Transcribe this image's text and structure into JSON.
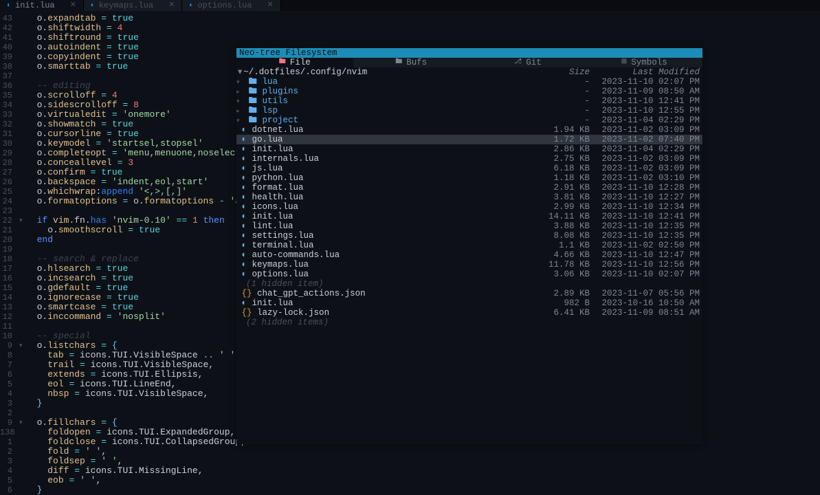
{
  "tabs": [
    {
      "name": "init.lua",
      "active": true
    },
    {
      "name": "keymaps.lua",
      "active": false
    },
    {
      "name": "options.lua",
      "active": false
    }
  ],
  "code": [
    {
      "n": "43",
      "c": "",
      "html": "  o.<span class='ident'>expandtab</span> <span class='op'>=</span> <span class='bool'>true</span>"
    },
    {
      "n": "42",
      "c": "",
      "html": "  o.<span class='ident'>shiftwidth</span> <span class='op'>=</span> <span class='num'>4</span>"
    },
    {
      "n": "41",
      "c": "",
      "html": "  o.<span class='ident'>shiftround</span> <span class='op'>=</span> <span class='bool'>true</span>"
    },
    {
      "n": "40",
      "c": "",
      "html": "  o.<span class='ident'>autoindent</span> <span class='op'>=</span> <span class='bool'>true</span>"
    },
    {
      "n": "39",
      "c": "",
      "html": "  o.<span class='ident'>copyindent</span> <span class='op'>=</span> <span class='bool'>true</span>"
    },
    {
      "n": "38",
      "c": "",
      "html": "  o.<span class='ident'>smarttab</span> <span class='op'>=</span> <span class='bool'>true</span>"
    },
    {
      "n": "37",
      "c": "",
      "html": ""
    },
    {
      "n": "36",
      "c": "",
      "html": "  <span class='comment'>-- editing</span>"
    },
    {
      "n": "35",
      "c": "",
      "html": "  o.<span class='ident'>scrolloff</span> <span class='op'>=</span> <span class='num'>4</span>"
    },
    {
      "n": "34",
      "c": "",
      "html": "  o.<span class='ident'>sidescrolloff</span> <span class='op'>=</span> <span class='num'>8</span>"
    },
    {
      "n": "33",
      "c": "",
      "html": "  o.<span class='ident'>virtualedit</span> <span class='op'>=</span> <span class='str'>'onemore'</span>"
    },
    {
      "n": "32",
      "c": "",
      "html": "  o.<span class='ident'>showmatch</span> <span class='op'>=</span> <span class='bool'>true</span>"
    },
    {
      "n": "31",
      "c": "",
      "html": "  o.<span class='ident'>cursorline</span> <span class='op'>=</span> <span class='bool'>true</span>"
    },
    {
      "n": "30",
      "c": "",
      "html": "  o.<span class='ident'>keymodel</span> <span class='op'>=</span> <span class='str'>'startsel,stopsel'</span>"
    },
    {
      "n": "29",
      "c": "",
      "html": "  o.<span class='ident'>completeopt</span> <span class='op'>=</span> <span class='str'>'menu,menuone,noselect'</span>"
    },
    {
      "n": "28",
      "c": "",
      "html": "  o.<span class='ident'>conceallevel</span> <span class='op'>=</span> <span class='num'>3</span>"
    },
    {
      "n": "27",
      "c": "",
      "html": "  o.<span class='ident'>confirm</span> <span class='op'>=</span> <span class='bool'>true</span>"
    },
    {
      "n": "26",
      "c": "",
      "html": "  o.<span class='ident'>backspace</span> <span class='op'>=</span> <span class='str'>'indent,eol,start'</span>"
    },
    {
      "n": "25",
      "c": "",
      "html": "  o.<span class='ident'>whichwrap</span>:<span class='fn'>append</span> <span class='str'>'<,>,[,]'</span>"
    },
    {
      "n": "24",
      "c": "",
      "html": "  o.<span class='ident'>formatoptions</span> <span class='op'>=</span> o.<span class='ident'>formatoptions</span> <span class='op'>-</span> <span class='str'>'a'</span> <span class='op'>-</span>"
    },
    {
      "n": "23",
      "c": "",
      "html": ""
    },
    {
      "n": "22",
      "c": "▾",
      "html": "  <span class='kw'>if</span> <span class='ident'>vim</span>.fn.<span class='fn'>has</span> <span class='str'>'nvim-0.10'</span> <span class='op'>==</span> <span class='num'>1</span> <span class='kw'>then</span>"
    },
    {
      "n": "21",
      "c": "",
      "html": "    o.<span class='ident'>smoothscroll</span> <span class='op'>=</span> <span class='bool'>true</span>"
    },
    {
      "n": "20",
      "c": "",
      "html": "  <span class='kw'>end</span>"
    },
    {
      "n": "19",
      "c": "",
      "html": ""
    },
    {
      "n": "18",
      "c": "",
      "html": "  <span class='comment'>-- search & replace</span>"
    },
    {
      "n": "17",
      "c": "",
      "html": "  o.<span class='ident'>hlsearch</span> <span class='op'>=</span> <span class='bool'>true</span>"
    },
    {
      "n": "16",
      "c": "",
      "html": "  o.<span class='ident'>incsearch</span> <span class='op'>=</span> <span class='bool'>true</span>"
    },
    {
      "n": "15",
      "c": "",
      "html": "  o.<span class='ident'>gdefault</span> <span class='op'>=</span> <span class='bool'>true</span>"
    },
    {
      "n": "14",
      "c": "",
      "html": "  o.<span class='ident'>ignorecase</span> <span class='op'>=</span> <span class='bool'>true</span>"
    },
    {
      "n": "13",
      "c": "",
      "html": "  o.<span class='ident'>smartcase</span> <span class='op'>=</span> <span class='bool'>true</span>"
    },
    {
      "n": "12",
      "c": "",
      "html": "  o.<span class='ident'>inccommand</span> <span class='op'>=</span> <span class='str'>'nosplit'</span>"
    },
    {
      "n": "11",
      "c": "",
      "html": ""
    },
    {
      "n": "10",
      "c": "",
      "html": "  <span class='comment'>-- special</span>"
    },
    {
      "n": "9",
      "c": "▾",
      "html": "  o.<span class='ident'>listchars</span> <span class='op'>=</span> <span class='punct'>{</span>"
    },
    {
      "n": "8",
      "c": "",
      "html": "    <span class='ident'>tab</span> <span class='op'>=</span> icons.TUI.VisibleSpace <span class='op'>..</span> <span class='str'>' '</span>,"
    },
    {
      "n": "7",
      "c": "",
      "html": "    <span class='ident'>trail</span> <span class='op'>=</span> icons.TUI.VisibleSpace,"
    },
    {
      "n": "6",
      "c": "",
      "html": "    <span class='ident'>extends</span> <span class='op'>=</span> icons.TUI.Ellipsis,"
    },
    {
      "n": "5",
      "c": "",
      "html": "    <span class='ident'>eol</span> <span class='op'>=</span> icons.TUI.LineEnd,"
    },
    {
      "n": "4",
      "c": "",
      "html": "    <span class='ident'>nbsp</span> <span class='op'>=</span> icons.TUI.VisibleSpace,"
    },
    {
      "n": "3",
      "c": "",
      "html": "  <span class='punct'>}</span>"
    },
    {
      "n": "2",
      "c": "",
      "html": ""
    },
    {
      "n": "9",
      "c": "▾",
      "html": "  o.<span class='ident'>fillchars</span> <span class='op'>=</span> <span class='punct'>{</span>"
    },
    {
      "n": "138",
      "c": "",
      "html": "    <span class='ident'>foldopen</span> <span class='op'>=</span> icons.TUI.ExpandedGroup,"
    },
    {
      "n": "1",
      "c": "",
      "html": "    <span class='ident'>foldclose</span> <span class='op'>=</span> icons.TUI.CollapsedGroup,"
    },
    {
      "n": "2",
      "c": "",
      "html": "    <span class='ident'>fold</span> <span class='op'>=</span> <span class='str'>' '</span>,"
    },
    {
      "n": "3",
      "c": "",
      "html": "    <span class='ident'>foldsep</span> <span class='op'>=</span> <span class='str'>' '</span>,"
    },
    {
      "n": "4",
      "c": "",
      "html": "    <span class='ident'>diff</span> <span class='op'>=</span> icons.TUI.MissingLine,"
    },
    {
      "n": "5",
      "c": "",
      "html": "    <span class='ident'>eob</span> <span class='op'>=</span> <span class='str'>' '</span>,"
    },
    {
      "n": "6",
      "c": "",
      "html": "  <span class='punct'>}</span>"
    }
  ],
  "neotree": {
    "title": "Neo-tree Filesystem",
    "tabs": [
      {
        "icon": "🖿",
        "label": "File",
        "active": true
      },
      {
        "icon": "🖿",
        "label": "Bufs",
        "active": false
      },
      {
        "icon": "⎇",
        "label": "Git",
        "active": false
      },
      {
        "icon": "⊞",
        "label": "Symbols",
        "active": false
      }
    ],
    "path": "~/.dotfiles/.config/nvim",
    "headerSize": "Size",
    "headerDate": "Last Modified",
    "rows": [
      {
        "depth": 0,
        "type": "folder-open",
        "name": "lua",
        "size": "-",
        "date": "2023-11-10 02:07 PM"
      },
      {
        "depth": 1,
        "type": "folder",
        "name": "plugins",
        "size": "-",
        "date": "2023-11-09 08:50 AM"
      },
      {
        "depth": 1,
        "type": "folder-open",
        "name": "utils",
        "size": "-",
        "date": "2023-11-10 12:41 PM"
      },
      {
        "depth": 2,
        "type": "folder",
        "name": "lsp",
        "size": "-",
        "date": "2023-11-10 12:55 PM"
      },
      {
        "depth": 2,
        "type": "folder-open",
        "name": "project",
        "size": "-",
        "date": "2023-11-04 02:29 PM"
      },
      {
        "depth": 3,
        "type": "lua",
        "name": "dotnet.lua",
        "size": "1.94 KB",
        "date": "2023-11-02 03:09 PM"
      },
      {
        "depth": 3,
        "type": "lua",
        "name": "go.lua",
        "size": "1.72 KB",
        "date": "2023-11-02 07:40 PM",
        "selected": true
      },
      {
        "depth": 3,
        "type": "lua",
        "name": "init.lua",
        "size": "2.86 KB",
        "date": "2023-11-04 02:29 PM"
      },
      {
        "depth": 3,
        "type": "lua",
        "name": "internals.lua",
        "size": "2.75 KB",
        "date": "2023-11-02 03:09 PM"
      },
      {
        "depth": 3,
        "type": "lua",
        "name": "js.lua",
        "size": "6.18 KB",
        "date": "2023-11-02 03:09 PM"
      },
      {
        "depth": 3,
        "type": "lua",
        "name": "python.lua",
        "size": "1.18 KB",
        "date": "2023-11-02 03:10 PM"
      },
      {
        "depth": 2,
        "type": "lua",
        "name": "format.lua",
        "size": "2.91 KB",
        "date": "2023-11-10 12:28 PM"
      },
      {
        "depth": 2,
        "type": "lua",
        "name": "health.lua",
        "size": "3.81 KB",
        "date": "2023-11-10 12:27 PM"
      },
      {
        "depth": 2,
        "type": "lua",
        "name": "icons.lua",
        "size": "2.99 KB",
        "date": "2023-11-10 12:34 PM"
      },
      {
        "depth": 2,
        "type": "lua",
        "name": "init.lua",
        "size": "14.11 KB",
        "date": "2023-11-10 12:41 PM"
      },
      {
        "depth": 2,
        "type": "lua",
        "name": "lint.lua",
        "size": "3.88 KB",
        "date": "2023-11-10 12:35 PM"
      },
      {
        "depth": 2,
        "type": "lua",
        "name": "settings.lua",
        "size": "8.08 KB",
        "date": "2023-11-10 12:35 PM"
      },
      {
        "depth": 2,
        "type": "lua",
        "name": "terminal.lua",
        "size": "1.1 KB",
        "date": "2023-11-02 02:50 PM"
      },
      {
        "depth": 1,
        "type": "lua",
        "name": "auto-commands.lua",
        "size": "4.66 KB",
        "date": "2023-11-10 12:47 PM"
      },
      {
        "depth": 1,
        "type": "lua",
        "name": "keymaps.lua",
        "size": "11.78 KB",
        "date": "2023-11-10 12:56 PM"
      },
      {
        "depth": 1,
        "type": "lua",
        "name": "options.lua",
        "size": "3.06 KB",
        "date": "2023-11-10 02:07 PM"
      },
      {
        "depth": 1,
        "type": "hidden",
        "name": "(1 hidden item)"
      },
      {
        "depth": 0,
        "type": "json",
        "name": "chat_gpt_actions.json",
        "size": "2.89 KB",
        "date": "2023-11-07 05:56 PM"
      },
      {
        "depth": 0,
        "type": "lua",
        "name": "init.lua",
        "size": "982 B",
        "date": "2023-10-16 10:50 AM"
      },
      {
        "depth": 0,
        "type": "json",
        "name": "lazy-lock.json",
        "size": "6.41 KB",
        "date": "2023-11-09 08:51 AM"
      },
      {
        "depth": 0,
        "type": "hidden",
        "name": "(2 hidden items)"
      }
    ]
  }
}
